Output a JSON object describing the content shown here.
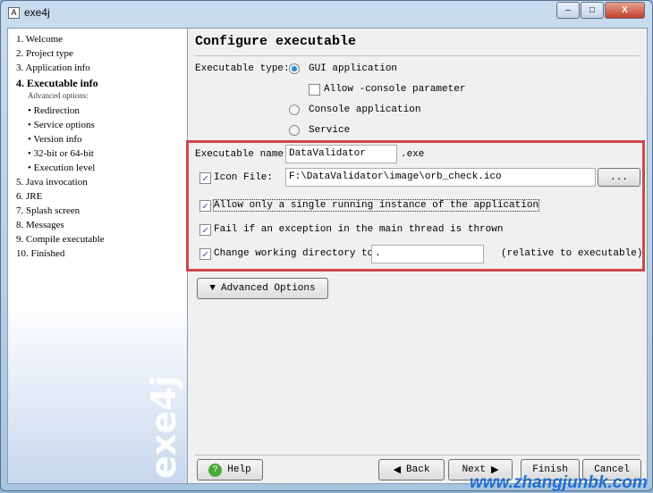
{
  "window": {
    "title": "exe4j",
    "minimize": "–",
    "maximize": "□",
    "close": "X"
  },
  "sidebar": {
    "items": [
      "1. Welcome",
      "2. Project type",
      "3. Application info",
      "4. Executable info",
      "Advanced options:",
      "• Redirection",
      "• Service options",
      "• Version info",
      "• 32-bit or 64-bit",
      "• Execution level",
      "5. Java invocation",
      "6. JRE",
      "7. Splash screen",
      "8. Messages",
      "9. Compile executable",
      "10. Finished"
    ],
    "active_index": 3,
    "logo": "exe4j"
  },
  "main": {
    "heading": "Configure executable",
    "exe_type_label": "Executable type:",
    "types": [
      {
        "label": "GUI application",
        "selected": true
      },
      {
        "label": "Console application",
        "selected": false
      },
      {
        "label": "Service",
        "selected": false
      }
    ],
    "allow_console": {
      "label": "Allow -console parameter",
      "checked": false
    },
    "exe_name_label": "Executable name:",
    "exe_name": "DataValidator",
    "exe_ext": ".exe",
    "icon_file": {
      "label": "Icon File:",
      "checked": true,
      "value": "F:\\DataValidator\\image\\orb_check.ico",
      "browse": "..."
    },
    "single_instance": {
      "label": "Allow only a single running instance of the application",
      "checked": true
    },
    "fail_exception": {
      "label": "Fail if an exception in the main thread is thrown",
      "checked": true
    },
    "change_dir": {
      "label": "Change working directory to:",
      "checked": true,
      "value": ".",
      "note": "(relative to executable)"
    },
    "advanced": "Advanced Options"
  },
  "footer": {
    "help": "Help",
    "back": "Back",
    "next": "Next",
    "finish": "Finish",
    "cancel": "Cancel"
  },
  "watermark": "www.zhangjunbk.com",
  "colors": {
    "highlight": "#d04848",
    "radio": "#2a8ad0"
  }
}
